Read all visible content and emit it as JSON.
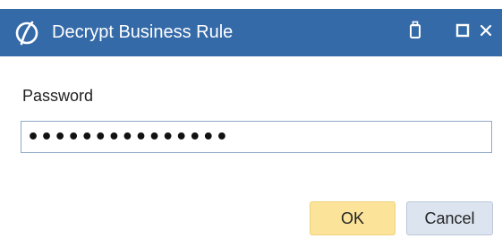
{
  "window": {
    "title": "Decrypt Business Rule",
    "logo_icon": "onestream-logo-icon",
    "controls": [
      {
        "name": "pin-button",
        "icon": "pin-icon"
      },
      {
        "name": "maximize-button",
        "icon": "maximize-icon"
      },
      {
        "name": "close-button",
        "icon": "close-icon"
      }
    ]
  },
  "form": {
    "password_label": "Password",
    "password_value": "•••••••••••••••"
  },
  "buttons": {
    "ok_label": "OK",
    "cancel_label": "Cancel"
  },
  "colors": {
    "titlebar": "#356aa8",
    "ok_button": "#fbe49a",
    "cancel_button": "#dce4f0"
  }
}
